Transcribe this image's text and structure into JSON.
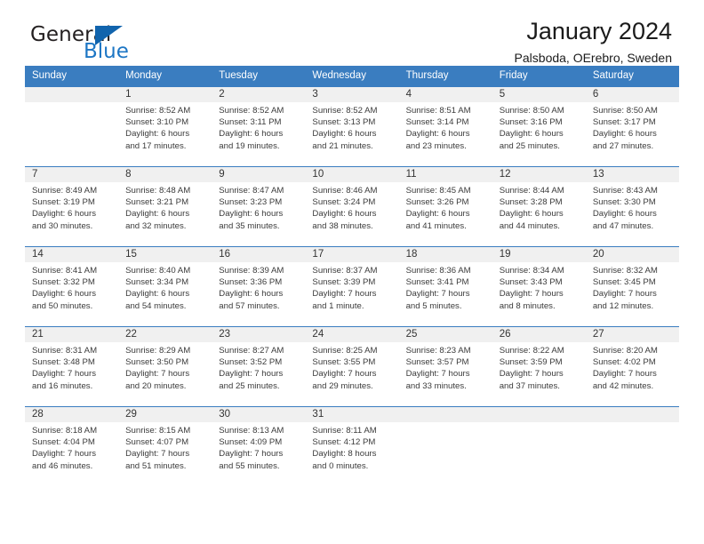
{
  "brand": {
    "name_top": "General",
    "name_bottom": "Blue",
    "accent_color": "#1164ad",
    "text_color": "#231f20"
  },
  "header": {
    "title": "January 2024",
    "subtitle": "Palsboda, OErebro, Sweden"
  },
  "calendar": {
    "header_bg": "#3a7dc0",
    "daynum_band_bg": "#f0f0f0",
    "weekdays": [
      "Sunday",
      "Monday",
      "Tuesday",
      "Wednesday",
      "Thursday",
      "Friday",
      "Saturday"
    ],
    "weeks": [
      [
        {
          "day": "",
          "empty": true
        },
        {
          "day": "1",
          "sunrise": "Sunrise: 8:52 AM",
          "sunset": "Sunset: 3:10 PM",
          "daylight1": "Daylight: 6 hours",
          "daylight2": "and 17 minutes."
        },
        {
          "day": "2",
          "sunrise": "Sunrise: 8:52 AM",
          "sunset": "Sunset: 3:11 PM",
          "daylight1": "Daylight: 6 hours",
          "daylight2": "and 19 minutes."
        },
        {
          "day": "3",
          "sunrise": "Sunrise: 8:52 AM",
          "sunset": "Sunset: 3:13 PM",
          "daylight1": "Daylight: 6 hours",
          "daylight2": "and 21 minutes."
        },
        {
          "day": "4",
          "sunrise": "Sunrise: 8:51 AM",
          "sunset": "Sunset: 3:14 PM",
          "daylight1": "Daylight: 6 hours",
          "daylight2": "and 23 minutes."
        },
        {
          "day": "5",
          "sunrise": "Sunrise: 8:50 AM",
          "sunset": "Sunset: 3:16 PM",
          "daylight1": "Daylight: 6 hours",
          "daylight2": "and 25 minutes."
        },
        {
          "day": "6",
          "sunrise": "Sunrise: 8:50 AM",
          "sunset": "Sunset: 3:17 PM",
          "daylight1": "Daylight: 6 hours",
          "daylight2": "and 27 minutes."
        }
      ],
      [
        {
          "day": "7",
          "sunrise": "Sunrise: 8:49 AM",
          "sunset": "Sunset: 3:19 PM",
          "daylight1": "Daylight: 6 hours",
          "daylight2": "and 30 minutes."
        },
        {
          "day": "8",
          "sunrise": "Sunrise: 8:48 AM",
          "sunset": "Sunset: 3:21 PM",
          "daylight1": "Daylight: 6 hours",
          "daylight2": "and 32 minutes."
        },
        {
          "day": "9",
          "sunrise": "Sunrise: 8:47 AM",
          "sunset": "Sunset: 3:23 PM",
          "daylight1": "Daylight: 6 hours",
          "daylight2": "and 35 minutes."
        },
        {
          "day": "10",
          "sunrise": "Sunrise: 8:46 AM",
          "sunset": "Sunset: 3:24 PM",
          "daylight1": "Daylight: 6 hours",
          "daylight2": "and 38 minutes."
        },
        {
          "day": "11",
          "sunrise": "Sunrise: 8:45 AM",
          "sunset": "Sunset: 3:26 PM",
          "daylight1": "Daylight: 6 hours",
          "daylight2": "and 41 minutes."
        },
        {
          "day": "12",
          "sunrise": "Sunrise: 8:44 AM",
          "sunset": "Sunset: 3:28 PM",
          "daylight1": "Daylight: 6 hours",
          "daylight2": "and 44 minutes."
        },
        {
          "day": "13",
          "sunrise": "Sunrise: 8:43 AM",
          "sunset": "Sunset: 3:30 PM",
          "daylight1": "Daylight: 6 hours",
          "daylight2": "and 47 minutes."
        }
      ],
      [
        {
          "day": "14",
          "sunrise": "Sunrise: 8:41 AM",
          "sunset": "Sunset: 3:32 PM",
          "daylight1": "Daylight: 6 hours",
          "daylight2": "and 50 minutes."
        },
        {
          "day": "15",
          "sunrise": "Sunrise: 8:40 AM",
          "sunset": "Sunset: 3:34 PM",
          "daylight1": "Daylight: 6 hours",
          "daylight2": "and 54 minutes."
        },
        {
          "day": "16",
          "sunrise": "Sunrise: 8:39 AM",
          "sunset": "Sunset: 3:36 PM",
          "daylight1": "Daylight: 6 hours",
          "daylight2": "and 57 minutes."
        },
        {
          "day": "17",
          "sunrise": "Sunrise: 8:37 AM",
          "sunset": "Sunset: 3:39 PM",
          "daylight1": "Daylight: 7 hours",
          "daylight2": "and 1 minute."
        },
        {
          "day": "18",
          "sunrise": "Sunrise: 8:36 AM",
          "sunset": "Sunset: 3:41 PM",
          "daylight1": "Daylight: 7 hours",
          "daylight2": "and 5 minutes."
        },
        {
          "day": "19",
          "sunrise": "Sunrise: 8:34 AM",
          "sunset": "Sunset: 3:43 PM",
          "daylight1": "Daylight: 7 hours",
          "daylight2": "and 8 minutes."
        },
        {
          "day": "20",
          "sunrise": "Sunrise: 8:32 AM",
          "sunset": "Sunset: 3:45 PM",
          "daylight1": "Daylight: 7 hours",
          "daylight2": "and 12 minutes."
        }
      ],
      [
        {
          "day": "21",
          "sunrise": "Sunrise: 8:31 AM",
          "sunset": "Sunset: 3:48 PM",
          "daylight1": "Daylight: 7 hours",
          "daylight2": "and 16 minutes."
        },
        {
          "day": "22",
          "sunrise": "Sunrise: 8:29 AM",
          "sunset": "Sunset: 3:50 PM",
          "daylight1": "Daylight: 7 hours",
          "daylight2": "and 20 minutes."
        },
        {
          "day": "23",
          "sunrise": "Sunrise: 8:27 AM",
          "sunset": "Sunset: 3:52 PM",
          "daylight1": "Daylight: 7 hours",
          "daylight2": "and 25 minutes."
        },
        {
          "day": "24",
          "sunrise": "Sunrise: 8:25 AM",
          "sunset": "Sunset: 3:55 PM",
          "daylight1": "Daylight: 7 hours",
          "daylight2": "and 29 minutes."
        },
        {
          "day": "25",
          "sunrise": "Sunrise: 8:23 AM",
          "sunset": "Sunset: 3:57 PM",
          "daylight1": "Daylight: 7 hours",
          "daylight2": "and 33 minutes."
        },
        {
          "day": "26",
          "sunrise": "Sunrise: 8:22 AM",
          "sunset": "Sunset: 3:59 PM",
          "daylight1": "Daylight: 7 hours",
          "daylight2": "and 37 minutes."
        },
        {
          "day": "27",
          "sunrise": "Sunrise: 8:20 AM",
          "sunset": "Sunset: 4:02 PM",
          "daylight1": "Daylight: 7 hours",
          "daylight2": "and 42 minutes."
        }
      ],
      [
        {
          "day": "28",
          "sunrise": "Sunrise: 8:18 AM",
          "sunset": "Sunset: 4:04 PM",
          "daylight1": "Daylight: 7 hours",
          "daylight2": "and 46 minutes."
        },
        {
          "day": "29",
          "sunrise": "Sunrise: 8:15 AM",
          "sunset": "Sunset: 4:07 PM",
          "daylight1": "Daylight: 7 hours",
          "daylight2": "and 51 minutes."
        },
        {
          "day": "30",
          "sunrise": "Sunrise: 8:13 AM",
          "sunset": "Sunset: 4:09 PM",
          "daylight1": "Daylight: 7 hours",
          "daylight2": "and 55 minutes."
        },
        {
          "day": "31",
          "sunrise": "Sunrise: 8:11 AM",
          "sunset": "Sunset: 4:12 PM",
          "daylight1": "Daylight: 8 hours",
          "daylight2": "and 0 minutes."
        },
        {
          "day": "",
          "empty": true
        },
        {
          "day": "",
          "empty": true
        },
        {
          "day": "",
          "empty": true
        }
      ]
    ]
  }
}
